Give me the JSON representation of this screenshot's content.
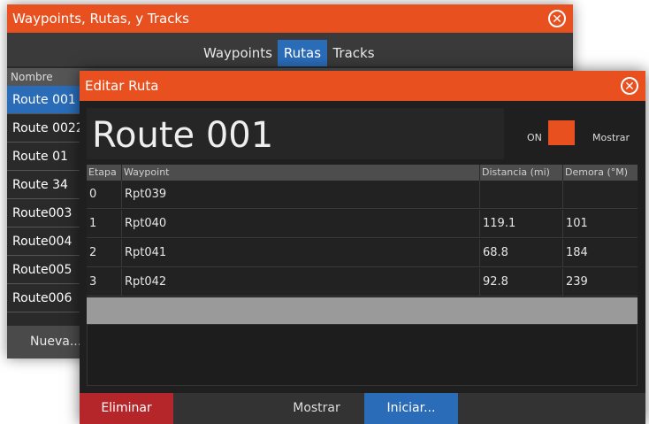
{
  "back_window": {
    "title": "Waypoints, Rutas, y Tracks",
    "close_glyph": "✕",
    "tabs": [
      "Waypoints",
      "Rutas",
      "Tracks"
    ],
    "active_tab": "Rutas",
    "column_header": "Nombre",
    "routes": [
      "Route 001",
      "Route 0022",
      "Route 01",
      "Route 34",
      "Route003",
      "Route004",
      "Route005",
      "Route006"
    ],
    "selected_route": "Route 001",
    "new_button": "Nueva..."
  },
  "dialog": {
    "title": "Editar Ruta",
    "close_glyph": "✕",
    "route_name": "Route 001",
    "toggle_state": "ON",
    "show_label": "Mostrar",
    "columns": [
      "Etapa",
      "Waypoint",
      "Distancia (mi)",
      "Demora (°M)"
    ],
    "rows": [
      {
        "stage": "0",
        "waypoint": "Rpt039",
        "distance": "",
        "bearing": ""
      },
      {
        "stage": "1",
        "waypoint": "Rpt040",
        "distance": "119.1",
        "bearing": "101"
      },
      {
        "stage": "2",
        "waypoint": "Rpt041",
        "distance": "68.8",
        "bearing": "184"
      },
      {
        "stage": "3",
        "waypoint": "Rpt042",
        "distance": "92.8",
        "bearing": "239"
      }
    ],
    "buttons": {
      "delete": "Eliminar",
      "show": "Mostrar",
      "start": "Iniciar..."
    }
  },
  "colors": {
    "accent": "#e8501f",
    "selected": "#2a6cb8",
    "delete": "#b5262b"
  }
}
